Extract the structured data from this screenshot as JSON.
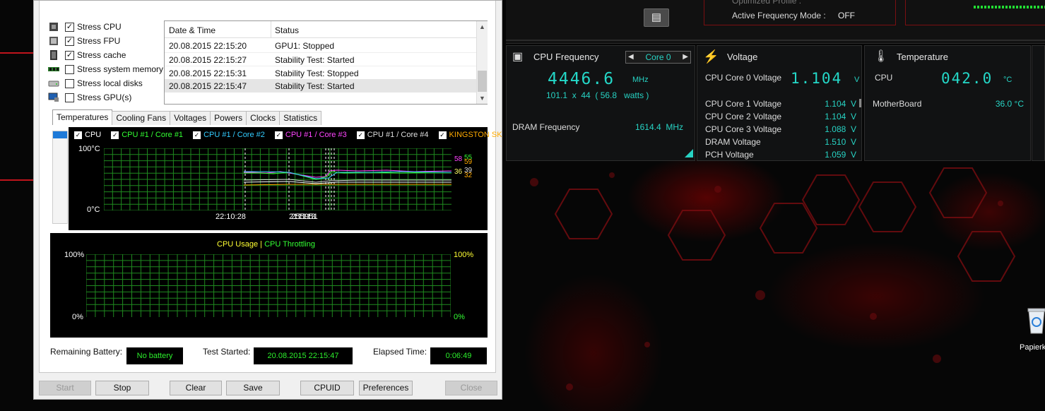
{
  "stress_options": [
    {
      "label": "Stress CPU",
      "checked": true,
      "icon": "cpu-chip-icon"
    },
    {
      "label": "Stress FPU",
      "checked": true,
      "icon": "fpu-chip-icon"
    },
    {
      "label": "Stress cache",
      "checked": true,
      "icon": "cache-chip-icon"
    },
    {
      "label": "Stress system memory",
      "checked": false,
      "icon": "memory-module-icon"
    },
    {
      "label": "Stress local disks",
      "checked": false,
      "icon": "disk-drive-icon"
    },
    {
      "label": "Stress GPU(s)",
      "checked": false,
      "icon": "monitor-icon"
    }
  ],
  "log": {
    "col_date": "Date & Time",
    "col_status": "Status",
    "rows": [
      {
        "date": "20.08.2015 22:15:20",
        "status": "GPU1: Stopped"
      },
      {
        "date": "20.08.2015 22:15:27",
        "status": "Stability Test: Started"
      },
      {
        "date": "20.08.2015 22:15:31",
        "status": "Stability Test: Stopped"
      },
      {
        "date": "20.08.2015 22:15:47",
        "status": "Stability Test: Started"
      }
    ]
  },
  "tabs": [
    "Temperatures",
    "Cooling Fans",
    "Voltages",
    "Powers",
    "Clocks",
    "Statistics"
  ],
  "active_tab": "Temperatures",
  "temp_graph": {
    "legend": [
      {
        "label": "CPU",
        "color": "#ffffff"
      },
      {
        "label": "CPU #1 / Core #1",
        "color": "#33ff33"
      },
      {
        "label": "CPU #1 / Core #2",
        "color": "#33ccff"
      },
      {
        "label": "CPU #1 / Core #3",
        "color": "#ff44ff"
      },
      {
        "label": "CPU #1 / Core #4",
        "color": "#dddddd"
      },
      {
        "label": "KINGSTON SK",
        "color": "#ffaa00"
      }
    ],
    "y_top": "100°C",
    "y_bottom": "0°C",
    "x_time1": "22:10:28",
    "x_time2": "22:15:15:19:15:31",
    "end_values": [
      "58",
      "55",
      "59",
      "36",
      "39",
      "32"
    ]
  },
  "usage_graph": {
    "label_usage": "CPU Usage",
    "sep": "|",
    "label_throttling": "CPU Throttling",
    "y_top_left": "100%",
    "y_bottom_left": "0%",
    "y_top_right": "100%",
    "y_bottom_right": "0%"
  },
  "status_bar": {
    "battery_label": "Remaining Battery:",
    "battery_value": "No battery",
    "started_label": "Test Started:",
    "started_value": "20.08.2015 22:15:47",
    "elapsed_label": "Elapsed Time:",
    "elapsed_value": "0:06:49"
  },
  "buttons": {
    "start": "Start",
    "stop": "Stop",
    "clear": "Clear",
    "save": "Save",
    "cpuid": "CPUID",
    "preferences": "Preferences",
    "close": "Close"
  },
  "suite": {
    "optimized_label": "Optimized Profile :",
    "afm_label": "Active Frequency Mode :",
    "afm_value": "OFF",
    "cpu_freq": {
      "title": "CPU Frequency",
      "core_select": "Core 0",
      "value": "4446.6",
      "unit": "MHz",
      "detail": "101.1  x  44  ( 56.8   watts )",
      "dram_label": "DRAM Frequency",
      "dram_value": "1614.4  MHz"
    },
    "voltage": {
      "title": "Voltage",
      "core0_label": "CPU Core 0 Voltage",
      "core0_value": "1.104",
      "core0_unit": "V",
      "rows": [
        {
          "label": "CPU Core 1 Voltage",
          "value": "1.104  V"
        },
        {
          "label": "CPU Core 2 Voltage",
          "value": "1.104  V"
        },
        {
          "label": "CPU Core 3 Voltage",
          "value": "1.088  V"
        },
        {
          "label": "DRAM Voltage",
          "value": "1.510  V"
        },
        {
          "label": "PCH Voltage",
          "value": "1.059  V"
        }
      ]
    },
    "temperature": {
      "title": "Temperature",
      "cpu_label": "CPU",
      "cpu_value": "042.0",
      "cpu_unit": "°C",
      "mb_label": "MotherBoard",
      "mb_value": "36.0 °C"
    }
  },
  "desktop": {
    "recycle_label": "Papierk"
  }
}
